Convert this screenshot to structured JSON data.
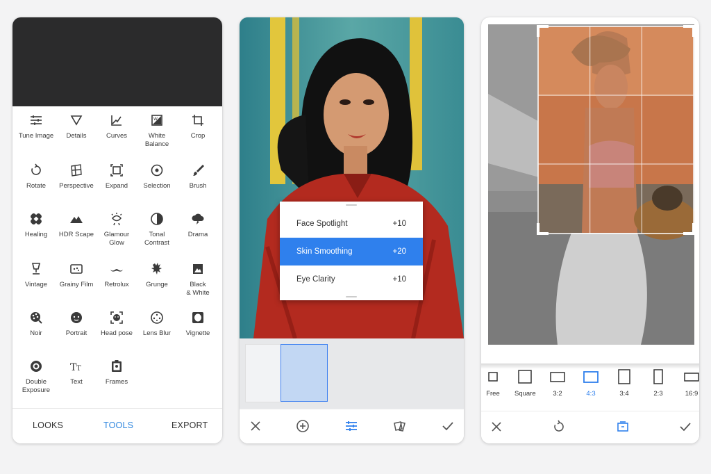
{
  "colors": {
    "accent": "#2e86de",
    "highlight": "#2f80ed",
    "icon": "#3a3a3a"
  },
  "phone1": {
    "tools": [
      {
        "label": "Tune Image",
        "icon": "tune-icon"
      },
      {
        "label": "Details",
        "icon": "details-triangle-icon"
      },
      {
        "label": "Curves",
        "icon": "curves-icon"
      },
      {
        "label": "White\nBalance",
        "icon": "white-balance-icon"
      },
      {
        "label": "Crop",
        "icon": "crop-icon"
      },
      {
        "label": "Rotate",
        "icon": "rotate-icon"
      },
      {
        "label": "Perspective",
        "icon": "perspective-icon"
      },
      {
        "label": "Expand",
        "icon": "expand-icon"
      },
      {
        "label": "Selection",
        "icon": "selection-icon"
      },
      {
        "label": "Brush",
        "icon": "brush-icon"
      },
      {
        "label": "Healing",
        "icon": "healing-icon"
      },
      {
        "label": "HDR Scape",
        "icon": "hdr-mountain-icon"
      },
      {
        "label": "Glamour\nGlow",
        "icon": "glamour-glow-icon"
      },
      {
        "label": "Tonal\nContrast",
        "icon": "tonal-contrast-icon"
      },
      {
        "label": "Drama",
        "icon": "drama-cloud-icon"
      },
      {
        "label": "Vintage",
        "icon": "vintage-lamp-icon"
      },
      {
        "label": "Grainy Film",
        "icon": "grainy-film-icon"
      },
      {
        "label": "Retrolux",
        "icon": "retrolux-mustache-icon"
      },
      {
        "label": "Grunge",
        "icon": "grunge-icon"
      },
      {
        "label": "Black\n& White",
        "icon": "black-white-icon"
      },
      {
        "label": "Noir",
        "icon": "noir-icon"
      },
      {
        "label": "Portrait",
        "icon": "portrait-face-icon"
      },
      {
        "label": "Head pose",
        "icon": "head-pose-icon"
      },
      {
        "label": "Lens Blur",
        "icon": "lens-blur-icon"
      },
      {
        "label": "Vignette",
        "icon": "vignette-icon"
      },
      {
        "label": "Double\nExposure",
        "icon": "double-exposure-icon"
      },
      {
        "label": "Text",
        "icon": "text-icon"
      },
      {
        "label": "Frames",
        "icon": "frames-icon"
      }
    ],
    "nav": {
      "looks": "LOOKS",
      "tools": "TOOLS",
      "export": "EXPORT",
      "active": "TOOLS"
    }
  },
  "phone2": {
    "adjustments": [
      {
        "label": "Face Spotlight",
        "value": "+10"
      },
      {
        "label": "Skin Smoothing",
        "value": "+20",
        "selected": true
      },
      {
        "label": "Eye Clarity",
        "value": "+10"
      }
    ],
    "toolbar": [
      "close-icon",
      "add-circle-icon",
      "sliders-icon",
      "styles-icon",
      "check-icon"
    ]
  },
  "phone3": {
    "ratios": [
      {
        "label": "Free"
      },
      {
        "label": "Square"
      },
      {
        "label": "3:2"
      },
      {
        "label": "4:3",
        "selected": true
      },
      {
        "label": "3:4"
      },
      {
        "label": "2:3"
      },
      {
        "label": "16:9"
      }
    ],
    "toolbar": [
      "close-icon",
      "rotate-icon",
      "orientation-icon",
      "check-icon"
    ]
  }
}
